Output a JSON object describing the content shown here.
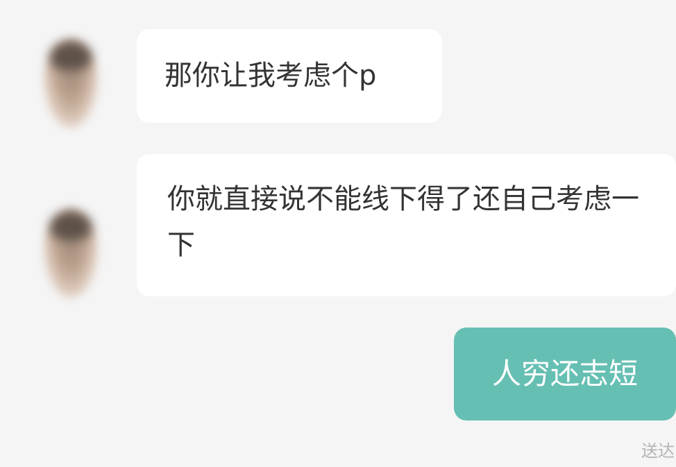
{
  "messages": [
    {
      "direction": "incoming",
      "text": "那你让我考虑个p"
    },
    {
      "direction": "incoming",
      "text": "你就直接说不能线下得了还自己考虑一下"
    },
    {
      "direction": "outgoing",
      "text": "人穷还志短"
    }
  ],
  "status_text": "送达",
  "colors": {
    "background": "#f5f5f5",
    "incoming_bubble": "#ffffff",
    "outgoing_bubble": "#66bfb3",
    "text": "#333333"
  }
}
